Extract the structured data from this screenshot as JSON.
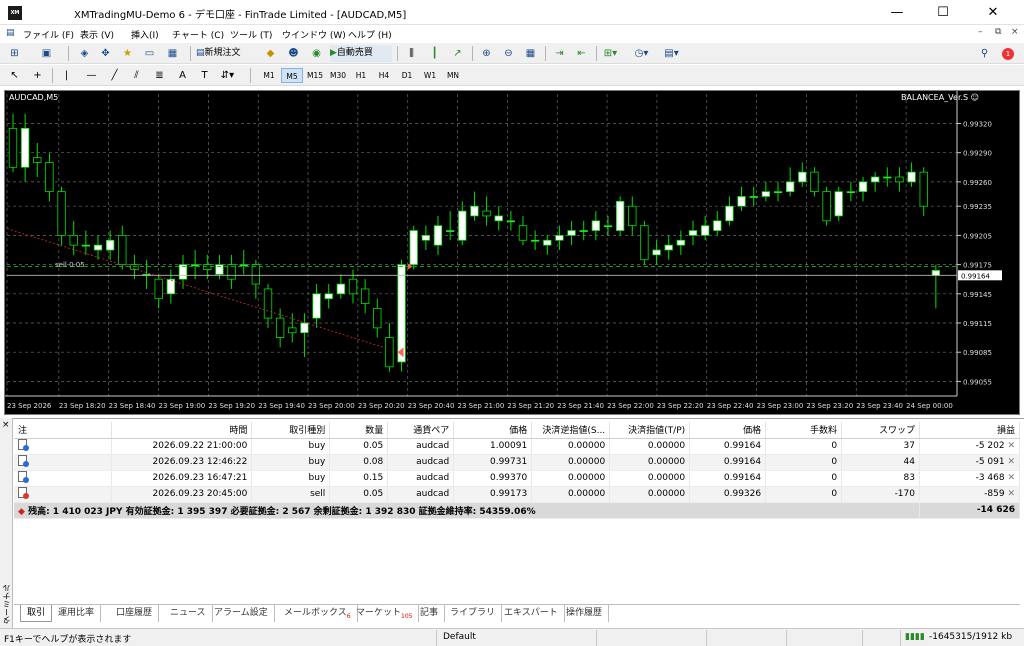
{
  "window": {
    "title": "XMTradingMU-Demo 6 - デモ口座 - FinTrade Limited - [AUDCAD,M5]",
    "app_icon_text": "XM",
    "minimize": "—",
    "maximize": "☐",
    "close": "✕"
  },
  "menu": {
    "items": [
      "ファイル (F)",
      "表示 (V)",
      "挿入(I)",
      "チャート (C)",
      "ツール (T)",
      "ウインドウ (W)",
      "ヘルプ (H)"
    ]
  },
  "toolbar": {
    "new_order_label": "新規注文",
    "auto_trading_label": "自動売買",
    "timeframes": [
      "M1",
      "M5",
      "M15",
      "M30",
      "H1",
      "H4",
      "D1",
      "W1",
      "MN"
    ],
    "selected_timeframe": "M5",
    "notification_count": "1"
  },
  "chart": {
    "symbol_label": "AUDCAD,M5",
    "ea_label": "BALANCEA_Ver.S ☺",
    "sell_marker_label": "sell 0.05",
    "current_price_label": "0.99164",
    "colors": {
      "background": "#000000",
      "bull": "#ffffff",
      "bear": "#000000",
      "outline": "#00e000",
      "grid": "#6a6a6a",
      "dash_line": "#d03030"
    }
  },
  "chart_data": {
    "type": "candlestick",
    "symbol": "AUDCAD",
    "timeframe": "M5",
    "y_ticks": [
      "0.99320",
      "0.99290",
      "0.99260",
      "0.99235",
      "0.99205",
      "0.99175",
      "0.99145",
      "0.99115",
      "0.99085",
      "0.99055"
    ],
    "ylim": [
      0.9904,
      0.9934
    ],
    "x_ticks": [
      "23 Sep 2026",
      "23 Sep 18:20",
      "23 Sep 18:40",
      "23 Sep 19:00",
      "23 Sep 19:20",
      "23 Sep 19:40",
      "23 Sep 20:00",
      "23 Sep 20:20",
      "23 Sep 20:40",
      "23 Sep 21:00",
      "23 Sep 21:20",
      "23 Sep 21:40",
      "23 Sep 22:00",
      "23 Sep 22:20",
      "23 Sep 22:40",
      "23 Sep 23:00",
      "23 Sep 23:20",
      "23 Sep 23:40",
      "24 Sep 00:00"
    ],
    "current_price": 0.99164,
    "candles": [
      [
        0.99315,
        0.99275,
        0.9933,
        0.9927
      ],
      [
        0.99275,
        0.99315,
        0.9933,
        0.9926
      ],
      [
        0.99285,
        0.9928,
        0.993,
        0.99265
      ],
      [
        0.9928,
        0.9925,
        0.9929,
        0.9924
      ],
      [
        0.9925,
        0.99205,
        0.99255,
        0.99195
      ],
      [
        0.99205,
        0.99195,
        0.9922,
        0.99185
      ],
      [
        0.99195,
        0.99195,
        0.9921,
        0.99185
      ],
      [
        0.9919,
        0.99195,
        0.99205,
        0.9918
      ],
      [
        0.9919,
        0.992,
        0.9921,
        0.9918
      ],
      [
        0.99205,
        0.99175,
        0.99215,
        0.9917
      ],
      [
        0.99175,
        0.9917,
        0.99185,
        0.9916
      ],
      [
        0.99165,
        0.99165,
        0.9918,
        0.9915
      ],
      [
        0.9916,
        0.9914,
        0.99165,
        0.9913
      ],
      [
        0.99145,
        0.9916,
        0.9917,
        0.99135
      ],
      [
        0.9916,
        0.99175,
        0.99185,
        0.9915
      ],
      [
        0.99175,
        0.99175,
        0.9919,
        0.9916
      ],
      [
        0.99175,
        0.9917,
        0.99185,
        0.9916
      ],
      [
        0.99165,
        0.99175,
        0.99185,
        0.9916
      ],
      [
        0.99175,
        0.9916,
        0.99185,
        0.9915
      ],
      [
        0.99175,
        0.99175,
        0.9919,
        0.99165
      ],
      [
        0.99175,
        0.99155,
        0.9918,
        0.9914
      ],
      [
        0.9915,
        0.9912,
        0.99155,
        0.9911
      ],
      [
        0.9912,
        0.991,
        0.9913,
        0.9909
      ],
      [
        0.9911,
        0.99105,
        0.99125,
        0.99095
      ],
      [
        0.99105,
        0.99115,
        0.99125,
        0.9908
      ],
      [
        0.9912,
        0.99145,
        0.99155,
        0.9911
      ],
      [
        0.9914,
        0.99145,
        0.99155,
        0.9913
      ],
      [
        0.99145,
        0.99155,
        0.99165,
        0.9914
      ],
      [
        0.9916,
        0.99145,
        0.9917,
        0.99135
      ],
      [
        0.9915,
        0.99135,
        0.9916,
        0.99125
      ],
      [
        0.9913,
        0.9911,
        0.9914,
        0.991
      ],
      [
        0.991,
        0.9907,
        0.99115,
        0.99065
      ],
      [
        0.99075,
        0.99175,
        0.9918,
        0.99065
      ],
      [
        0.99175,
        0.9921,
        0.99215,
        0.9917
      ],
      [
        0.992,
        0.99205,
        0.99215,
        0.9919
      ],
      [
        0.99195,
        0.99215,
        0.99225,
        0.99185
      ],
      [
        0.9921,
        0.9921,
        0.9923,
        0.992
      ],
      [
        0.992,
        0.9923,
        0.9924,
        0.99195
      ],
      [
        0.99225,
        0.99235,
        0.9925,
        0.9922
      ],
      [
        0.9923,
        0.99225,
        0.99245,
        0.99215
      ],
      [
        0.9922,
        0.99225,
        0.99235,
        0.9921
      ],
      [
        0.9922,
        0.9922,
        0.9923,
        0.9921
      ],
      [
        0.99215,
        0.992,
        0.99225,
        0.99195
      ],
      [
        0.992,
        0.992,
        0.9921,
        0.9919
      ],
      [
        0.99195,
        0.992,
        0.99205,
        0.99185
      ],
      [
        0.992,
        0.99205,
        0.99215,
        0.9919
      ],
      [
        0.99205,
        0.9921,
        0.9922,
        0.99195
      ],
      [
        0.9921,
        0.9921,
        0.9922,
        0.992
      ],
      [
        0.9921,
        0.9922,
        0.9923,
        0.992
      ],
      [
        0.99215,
        0.99215,
        0.99225,
        0.99205
      ],
      [
        0.9921,
        0.9924,
        0.99245,
        0.99205
      ],
      [
        0.99235,
        0.99215,
        0.99245,
        0.99205
      ],
      [
        0.99215,
        0.9918,
        0.9922,
        0.99175
      ],
      [
        0.99185,
        0.9919,
        0.992,
        0.99175
      ],
      [
        0.9919,
        0.99195,
        0.99205,
        0.9918
      ],
      [
        0.99195,
        0.992,
        0.9921,
        0.99185
      ],
      [
        0.99205,
        0.9921,
        0.9922,
        0.99195
      ],
      [
        0.99205,
        0.99215,
        0.99225,
        0.992
      ],
      [
        0.9921,
        0.9922,
        0.9923,
        0.99205
      ],
      [
        0.9922,
        0.99235,
        0.99245,
        0.99215
      ],
      [
        0.99235,
        0.99245,
        0.99255,
        0.9923
      ],
      [
        0.99245,
        0.99245,
        0.99255,
        0.99235
      ],
      [
        0.99245,
        0.9925,
        0.9926,
        0.9924
      ],
      [
        0.9925,
        0.9925,
        0.9926,
        0.9924
      ],
      [
        0.9925,
        0.9926,
        0.99275,
        0.99245
      ],
      [
        0.9926,
        0.9927,
        0.9928,
        0.99255
      ],
      [
        0.9927,
        0.9925,
        0.99275,
        0.99245
      ],
      [
        0.9925,
        0.9922,
        0.99255,
        0.99215
      ],
      [
        0.99225,
        0.9925,
        0.99255,
        0.9922
      ],
      [
        0.9925,
        0.9925,
        0.9926,
        0.9924
      ],
      [
        0.9925,
        0.9926,
        0.99265,
        0.9924
      ],
      [
        0.9926,
        0.99265,
        0.9927,
        0.9925
      ],
      [
        0.99265,
        0.99265,
        0.99275,
        0.99255
      ],
      [
        0.99265,
        0.9926,
        0.99275,
        0.9925
      ],
      [
        0.9926,
        0.9927,
        0.9928,
        0.99255
      ],
      [
        0.9927,
        0.99235,
        0.99275,
        0.99225
      ],
      [
        0.99164,
        0.99169,
        0.99175,
        0.9913
      ]
    ]
  },
  "terminal": {
    "side_label": "ターミナル",
    "columns": [
      "注",
      "時間",
      "取引種別",
      "数量",
      "通貨ペア",
      "価格",
      "決済逆指値(S...",
      "決済指値(T/P)",
      "価格",
      "手数料",
      "スワップ",
      "損益"
    ],
    "rows": [
      {
        "type": "buy",
        "time": "2026.09.22 21:00:00",
        "side": "buy",
        "volume": "0.05",
        "symbol": "audcad",
        "open_price": "1.00091",
        "sl": "0.00000",
        "tp": "0.00000",
        "price": "0.99164",
        "commission": "0",
        "swap": "37",
        "profit": "-5 202"
      },
      {
        "type": "buy",
        "time": "2026.09.23 12:46:22",
        "side": "buy",
        "volume": "0.08",
        "symbol": "audcad",
        "open_price": "0.99731",
        "sl": "0.00000",
        "tp": "0.00000",
        "price": "0.99164",
        "commission": "0",
        "swap": "44",
        "profit": "-5 091"
      },
      {
        "type": "buy",
        "time": "2026.09.23 16:47:21",
        "side": "buy",
        "volume": "0.15",
        "symbol": "audcad",
        "open_price": "0.99370",
        "sl": "0.00000",
        "tp": "0.00000",
        "price": "0.99164",
        "commission": "0",
        "swap": "83",
        "profit": "-3 468"
      },
      {
        "type": "sell",
        "time": "2026.09.23 20:45:00",
        "side": "sell",
        "volume": "0.05",
        "symbol": "audcad",
        "open_price": "0.99173",
        "sl": "0.00000",
        "tp": "0.00000",
        "price": "0.99326",
        "commission": "0",
        "swap": "-170",
        "profit": "-859"
      }
    ],
    "summary": "残高: 1 410 023 JPY  有効証拠金: 1 395 397  必要証拠金: 2 567  余剰証拠金: 1 392 830  証拠金維持率: 54359.06%",
    "summary_profit": "-14 626",
    "tabs": [
      {
        "label": "取引",
        "badge": ""
      },
      {
        "label": "運用比率",
        "badge": ""
      },
      {
        "label": "口座履歴",
        "badge": ""
      },
      {
        "label": "ニュース",
        "badge": ""
      },
      {
        "label": "アラーム設定",
        "badge": ""
      },
      {
        "label": "メールボックス",
        "badge": "6"
      },
      {
        "label": "マーケット",
        "badge": "105"
      },
      {
        "label": "記事",
        "badge": ""
      },
      {
        "label": "ライブラリ",
        "badge": ""
      },
      {
        "label": "エキスパート",
        "badge": ""
      },
      {
        "label": "操作履歴",
        "badge": ""
      }
    ]
  },
  "status": {
    "help": "F1キーでヘルプが表示されます",
    "profile": "Default",
    "traffic": "-1645315/1912 kb"
  }
}
